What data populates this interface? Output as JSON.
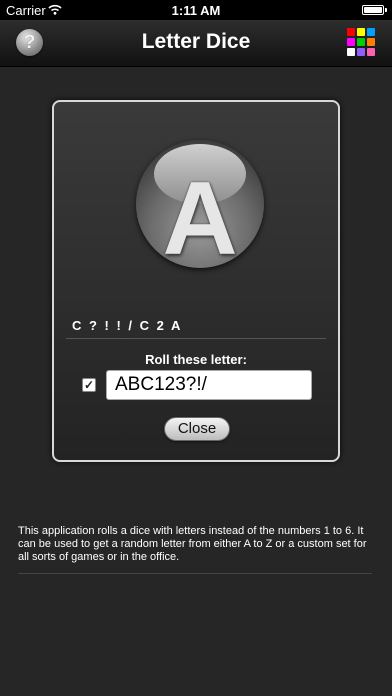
{
  "status_bar": {
    "carrier": "Carrier",
    "time": "1:11 AM"
  },
  "nav": {
    "title": "Letter Dice",
    "help_label": "?",
    "grid_colors": [
      "#ff0000",
      "#ffff00",
      "#00a0ff",
      "#ff00ff",
      "#00d000",
      "#ff8000",
      "#ffffff",
      "#9060ff",
      "#ff60b0"
    ]
  },
  "dice": {
    "current_letter": "A",
    "history": "C ? ! ! / C 2 A"
  },
  "settings": {
    "roll_label": "Roll these letter:",
    "custom_enabled": true,
    "letters_value": "ABC123?!/",
    "close_label": "Close"
  },
  "description": "This application rolls a dice with letters instead of the numbers 1 to 6. It can be used to get a random letter from either A to Z or a custom set for all sorts of games or in the office."
}
